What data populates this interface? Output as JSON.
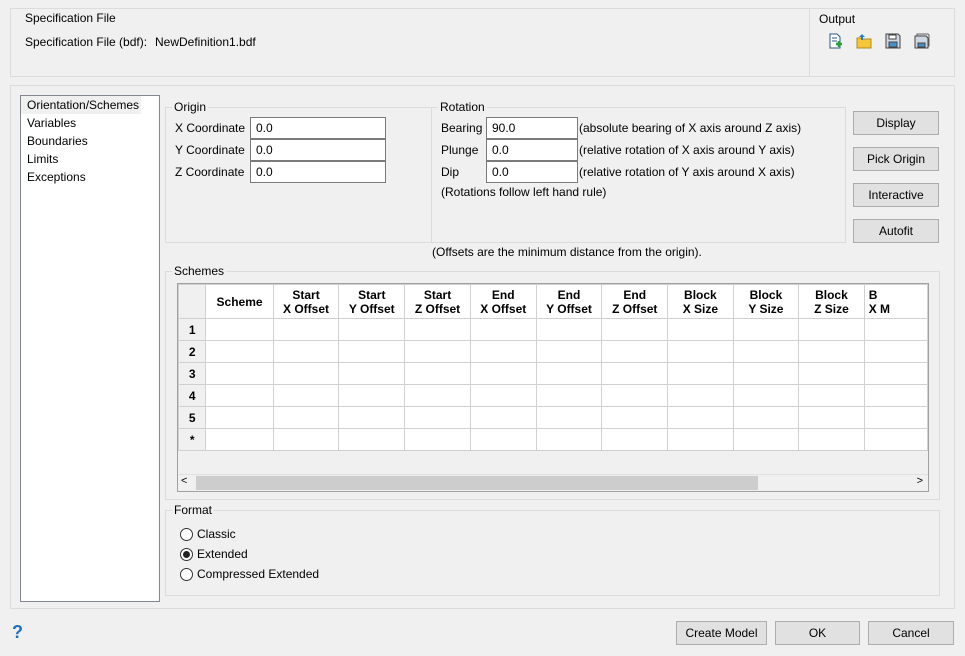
{
  "spec": {
    "group_label": "Specification File",
    "file_label": "Specification File (bdf):",
    "file_value": "NewDefinition1.bdf"
  },
  "output": {
    "group_label": "Output",
    "icons": [
      "new-file-icon",
      "open-folder-icon",
      "save-icon",
      "save-as-icon"
    ]
  },
  "sidebar": {
    "items": [
      {
        "label": "Orientation/Schemes",
        "selected": true
      },
      {
        "label": "Variables"
      },
      {
        "label": "Boundaries"
      },
      {
        "label": "Limits"
      },
      {
        "label": "Exceptions"
      }
    ]
  },
  "origin": {
    "group_label": "Origin",
    "fields": [
      {
        "label": "X Coordinate",
        "value": "0.0"
      },
      {
        "label": "Y Coordinate",
        "value": "0.0"
      },
      {
        "label": "Z Coordinate",
        "value": "0.0"
      }
    ]
  },
  "rotation": {
    "group_label": "Rotation",
    "fields": [
      {
        "label": "Bearing",
        "value": "90.0",
        "note": "(absolute bearing of X axis around Z axis)"
      },
      {
        "label": "Plunge",
        "value": "0.0",
        "note": "(relative rotation of X axis around Y axis)"
      },
      {
        "label": "Dip",
        "value": "0.0",
        "note": "(relative rotation of Y axis around X axis)"
      }
    ],
    "footnote": "(Rotations follow left hand rule)"
  },
  "side_buttons": [
    "Display",
    "Pick Origin",
    "Interactive",
    "Autofit"
  ],
  "offsets_note": "(Offsets are the minimum distance from the origin).",
  "schemes": {
    "group_label": "Schemes",
    "columns": [
      [
        "Scheme",
        ""
      ],
      [
        "Start",
        "X Offset"
      ],
      [
        "Start",
        "Y Offset"
      ],
      [
        "Start",
        "Z Offset"
      ],
      [
        "End",
        "X Offset"
      ],
      [
        "End",
        "Y Offset"
      ],
      [
        "End",
        "Z Offset"
      ],
      [
        "Block",
        "X Size"
      ],
      [
        "Block",
        "Y Size"
      ],
      [
        "Block",
        "Z Size"
      ],
      [
        "B",
        "X M"
      ]
    ],
    "rows": [
      "1",
      "2",
      "3",
      "4",
      "5",
      "*"
    ]
  },
  "format": {
    "group_label": "Format",
    "options": [
      {
        "label": "Classic",
        "checked": false
      },
      {
        "label": "Extended",
        "checked": true
      },
      {
        "label": "Compressed Extended",
        "checked": false
      }
    ]
  },
  "footer": {
    "help": "?",
    "create": "Create Model",
    "ok": "OK",
    "cancel": "Cancel"
  }
}
